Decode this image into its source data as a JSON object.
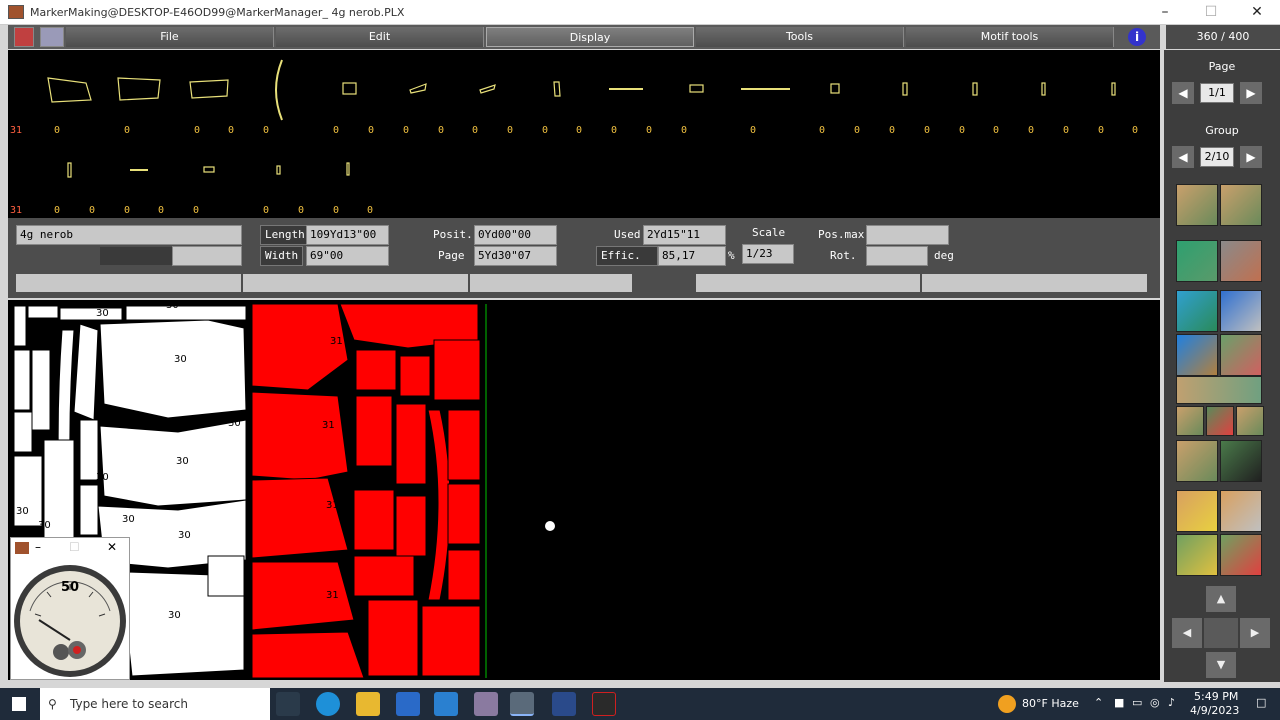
{
  "window": {
    "title": "MarkerMaking@DESKTOP-E46OD99@MarkerManager_ 4g nerob.PLX"
  },
  "menu": {
    "items": [
      "File",
      "Edit",
      "Display",
      "Tools",
      "Motif tools"
    ],
    "page_count": "360 / 400"
  },
  "pieces": {
    "row1_label": "31",
    "row1_counts": [
      "0",
      "0",
      "0",
      "0",
      "0",
      "0",
      "0",
      "0",
      "0",
      "0",
      "0",
      "0",
      "0",
      "0",
      "0",
      "0",
      "0",
      "0",
      "0",
      "0",
      "0",
      "0",
      "0",
      "0",
      "0",
      "0",
      "0",
      "0",
      "0"
    ],
    "row2_label": "31",
    "row2_counts": [
      "0",
      "0",
      "0",
      "0",
      "0",
      "0",
      "0",
      "0",
      "0"
    ]
  },
  "info": {
    "marker_name": "4g nerob",
    "length_label": "Length",
    "length_value": "109Yd13\"00",
    "width_label": "Width",
    "width_value": "69\"00",
    "posit_label": "Posit.",
    "posit_value": "0Yd00\"00",
    "page_label": "Page",
    "page_value": "5Yd30\"07",
    "used_label": "Used",
    "used_value": "2Yd15\"11",
    "effic_label": "Effic.",
    "effic_value": "85,17",
    "effic_unit": "%",
    "scale_label": "Scale",
    "scale_value": "1/23",
    "posmax_label": "Pos.max",
    "posmax_value": "",
    "rot_label": "Rot.",
    "rot_value": "",
    "rot_unit": "deg"
  },
  "right_panel": {
    "page_label": "Page",
    "page_value": "1/1",
    "group_label": "Group",
    "group_value": "2/10"
  },
  "meter": {
    "value": "50"
  },
  "canvas": {
    "piece_numbers": [
      "30",
      "30",
      "30",
      "30",
      "30",
      "30",
      "30",
      "31",
      "31",
      "31",
      "31",
      "30",
      "30",
      "30",
      "30",
      "30"
    ]
  },
  "taskbar": {
    "search_placeholder": "Type here to search",
    "weather": "80°F  Haze",
    "time": "5:49 PM",
    "date": "4/9/2023"
  }
}
